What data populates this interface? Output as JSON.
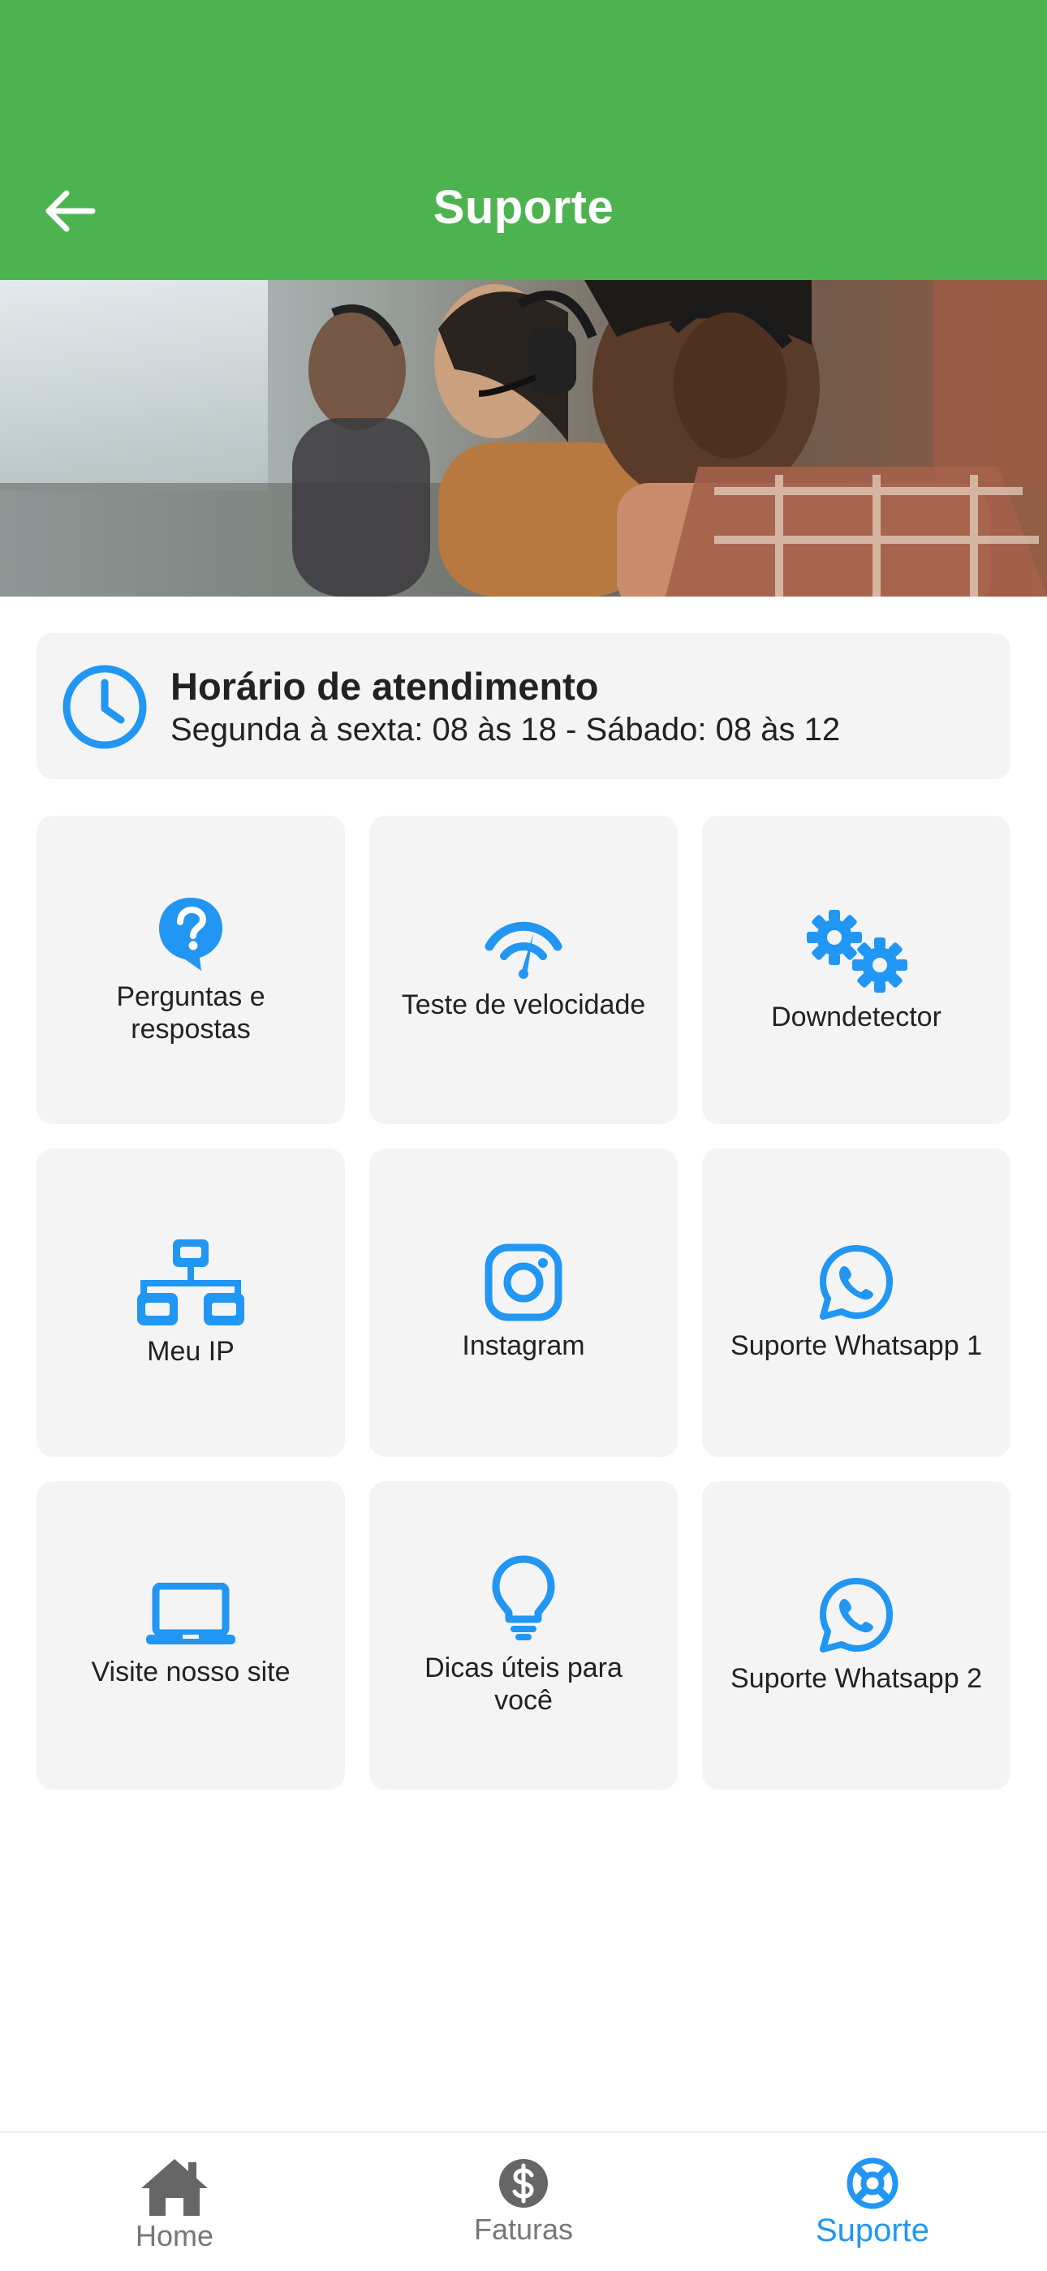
{
  "appbar": {
    "title": "Suporte",
    "color": "#4db351"
  },
  "hours": {
    "title": "Horário de atendimento",
    "schedule": "Segunda à sexta: 08 às 18 - Sábado: 08 às 12"
  },
  "tiles": [
    {
      "label": "Perguntas e respostas",
      "icon": "question-bubble-icon"
    },
    {
      "label": "Teste de velocidade",
      "icon": "speedometer-icon"
    },
    {
      "label": "Downdetector",
      "icon": "gears-icon"
    },
    {
      "label": "Meu IP",
      "icon": "network-icon"
    },
    {
      "label": "Instagram",
      "icon": "instagram-icon"
    },
    {
      "label": "Suporte Whatsapp 1",
      "icon": "whatsapp-icon"
    },
    {
      "label": "Visite nosso  site",
      "icon": "laptop-icon"
    },
    {
      "label": "Dicas úteis para você",
      "icon": "lightbulb-icon"
    },
    {
      "label": "Suporte Whatsapp 2",
      "icon": "whatsapp-icon"
    }
  ],
  "nav": {
    "items": [
      {
        "label": "Home",
        "icon": "home-icon"
      },
      {
        "label": "Faturas",
        "icon": "dollar-icon"
      },
      {
        "label": "Suporte",
        "icon": "lifebuoy-icon",
        "active": true
      }
    ],
    "active_color": "#2196f3",
    "inactive_color": "#666666"
  },
  "accent_color": "#2196f3"
}
